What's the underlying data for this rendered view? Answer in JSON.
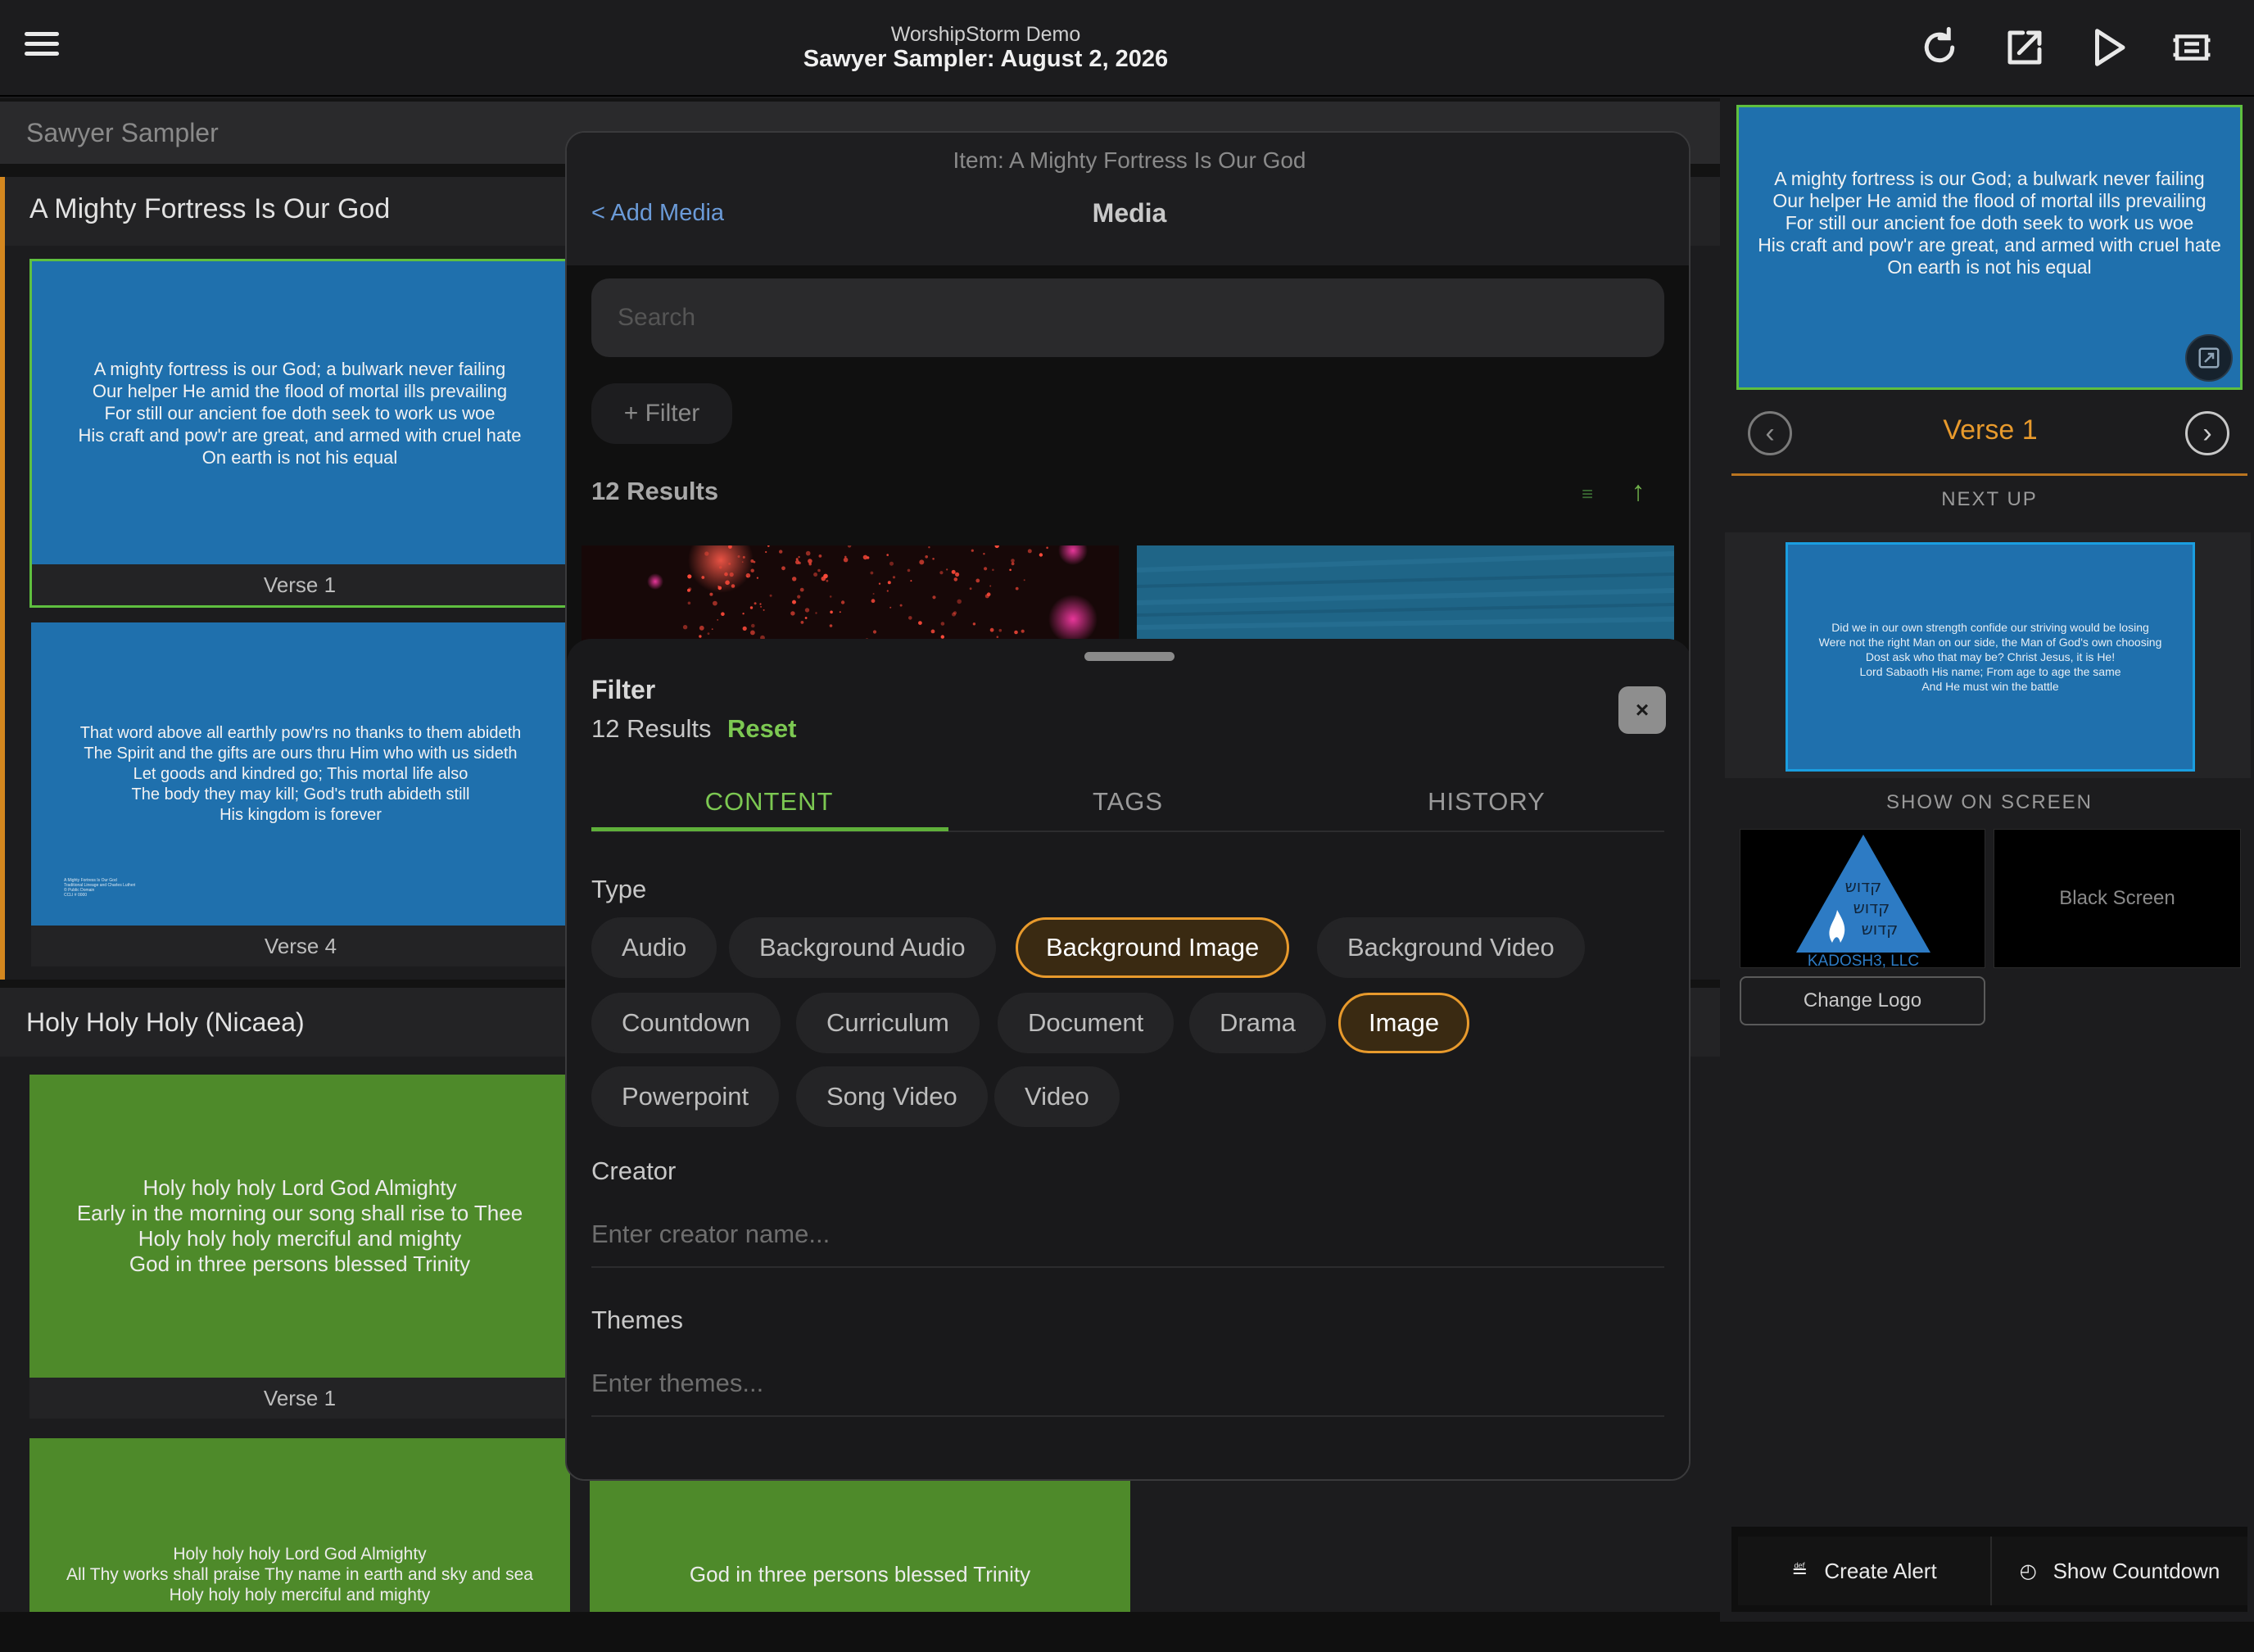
{
  "header": {
    "app_name": "WorshipStorm Demo",
    "title": "Sawyer Sampler: August 2, 2026",
    "icons": [
      "menu-icon",
      "refresh-icon",
      "edit-external-icon",
      "play-icon",
      "present-icon"
    ]
  },
  "left": {
    "service_name": "Sawyer Sampler",
    "sections": [
      {
        "title": "A Mighty Fortress Is Our God",
        "slides": [
          {
            "label": "Verse 1",
            "lines": [
              "A mighty fortress is our God; a bulwark never failing",
              "Our helper He amid the flood of mortal ills prevailing",
              "For still our ancient foe doth seek to work us woe",
              "His craft and pow'r are great, and armed with cruel hate",
              "On earth is not his equal"
            ]
          },
          {
            "label": "Verse 4",
            "lines": [
              "That word above all earthly pow'rs no thanks to them abideth",
              "The Spirit and the gifts are ours thru Him who with us sideth",
              "Let goods and kindred go; This mortal life also",
              "The body they may kill; God's truth abideth still",
              "His kingdom is forever"
            ],
            "credit_lines": [
              "A Mighty Fortress Is Our God",
              "Traditional Lineage and Charles Lutheri",
              "© Public Domain",
              "CCLI # 0000"
            ]
          }
        ]
      },
      {
        "title": "Holy Holy Holy (Nicaea)",
        "slides": [
          {
            "label": "Verse 1",
            "lines": [
              "Holy holy holy Lord God Almighty",
              "Early in the morning our song shall rise to Thee",
              "Holy holy holy merciful and mighty",
              "God in three persons blessed Trinity"
            ]
          },
          {
            "lines": [
              "Holy holy holy Lord God Almighty",
              "All Thy works shall praise Thy name in earth and sky and sea",
              "Holy holy holy merciful and mighty"
            ]
          },
          {
            "lines": [
              "God in three persons blessed Trinity"
            ]
          }
        ]
      }
    ]
  },
  "modal": {
    "item_title": "Item: A Mighty Fortress Is Our God",
    "back_label": "< Add Media",
    "title": "Media",
    "search_placeholder": "Search",
    "filter_button": "+ Filter",
    "results_count": "12 Results",
    "sheet": {
      "title": "Filter",
      "results": "12 Results",
      "reset": "Reset",
      "close": "×",
      "tabs": [
        "CONTENT",
        "TAGS",
        "HISTORY"
      ],
      "active_tab": "CONTENT",
      "type_label": "Type",
      "types": [
        {
          "label": "Audio",
          "selected": false
        },
        {
          "label": "Background Audio",
          "selected": false
        },
        {
          "label": "Background Image",
          "selected": true
        },
        {
          "label": "Background Video",
          "selected": false
        },
        {
          "label": "Countdown",
          "selected": false
        },
        {
          "label": "Curriculum",
          "selected": false
        },
        {
          "label": "Document",
          "selected": false
        },
        {
          "label": "Drama",
          "selected": false
        },
        {
          "label": "Image",
          "selected": true
        },
        {
          "label": "Powerpoint",
          "selected": false
        },
        {
          "label": "Song Video",
          "selected": false
        },
        {
          "label": "Video",
          "selected": false
        }
      ],
      "creator_label": "Creator",
      "creator_placeholder": "Enter creator name...",
      "themes_label": "Themes",
      "themes_placeholder": "Enter themes..."
    }
  },
  "right": {
    "live_lines": [
      "A mighty fortress is our God; a bulwark never failing",
      "Our helper He amid the flood of mortal ills prevailing",
      "For still our ancient foe doth seek to work us woe",
      "His craft and pow'r are great, and armed with cruel hate",
      "On earth is not his equal"
    ],
    "current_label": "Verse 1",
    "next_up_label": "NEXT UP",
    "next_lines": [
      "Did we in our own strength confide our striving would be losing",
      "Were not the right Man on our side, the Man of God's own choosing",
      "Dost ask who that may be? Christ Jesus, it is He!",
      "Lord Sabaoth His name; From age to age the same",
      "And He must win the battle"
    ],
    "show_on_screen_label": "SHOW ON SCREEN",
    "logo_text": "KADOSH3, LLC",
    "logo_hebrew": [
      "קדוש",
      "קדוש",
      "קדוש"
    ],
    "black_screen": "Black Screen",
    "change_logo": "Change Logo",
    "create_alert": "Create Alert",
    "show_countdown": "Show Countdown"
  },
  "colors": {
    "accent_orange": "#e89a2c",
    "accent_green": "#7cc852",
    "slide_blue": "#1f70ad",
    "slide_green": "#4e8a2a",
    "link_blue": "#6b9bd8"
  }
}
